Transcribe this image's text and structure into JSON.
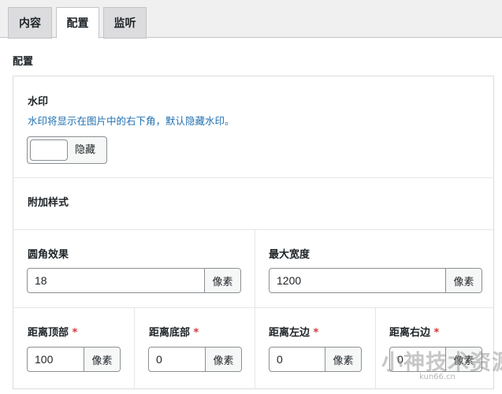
{
  "tabs": [
    {
      "label": "内容",
      "active": false
    },
    {
      "label": "配置",
      "active": true
    },
    {
      "label": "监听",
      "active": false
    }
  ],
  "section": {
    "title": "配置"
  },
  "watermark_setting": {
    "title": "水印",
    "description": "水印将显示在图片中的右下角，默认隐藏水印。",
    "toggle_label": "隐藏",
    "toggle_on": false
  },
  "extra_style": {
    "title": "附加样式"
  },
  "corner": {
    "label": "圆角效果",
    "value": "18",
    "unit": "像素"
  },
  "max_width": {
    "label": "最大宽度",
    "value": "1200",
    "unit": "像素"
  },
  "margin_top": {
    "label": "距离顶部",
    "required": "*",
    "value": "100",
    "unit": "像素"
  },
  "margin_bottom": {
    "label": "距离底部",
    "required": "*",
    "value": "0",
    "unit": "像素"
  },
  "margin_left": {
    "label": "距离左边",
    "required": "*",
    "value": "0",
    "unit": "像素"
  },
  "margin_right": {
    "label": "距离右边",
    "required": "*",
    "value": "0",
    "unit": "像素"
  },
  "overlay_watermark": {
    "main": "小神技术资源网",
    "sub": "kun66.cn"
  }
}
